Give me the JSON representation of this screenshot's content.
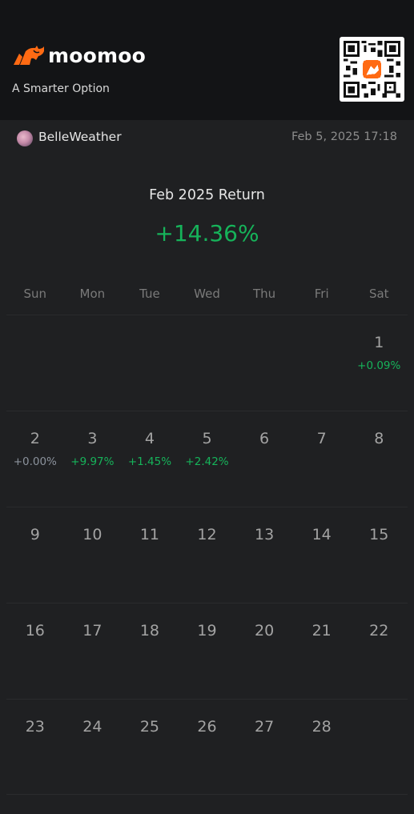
{
  "header": {
    "brand": "moomoo",
    "tagline": "A Smarter Option",
    "logo_icon": "bull-logo-icon",
    "qr_icon": "qr-code-icon",
    "brand_color": "#ff6a13"
  },
  "user": {
    "name": "BelleWeather",
    "timestamp": "Feb 5, 2025 17:18"
  },
  "summary": {
    "title": "Feb 2025 Return",
    "value": "+14.36%",
    "value_color": "#16b35a"
  },
  "calendar": {
    "weekdays": [
      "Sun",
      "Mon",
      "Tue",
      "Wed",
      "Thu",
      "Fri",
      "Sat"
    ],
    "weeks": [
      [
        {
          "day": "",
          "pct": ""
        },
        {
          "day": "",
          "pct": ""
        },
        {
          "day": "",
          "pct": ""
        },
        {
          "day": "",
          "pct": ""
        },
        {
          "day": "",
          "pct": ""
        },
        {
          "day": "",
          "pct": ""
        },
        {
          "day": "1",
          "pct": "+0.09%"
        }
      ],
      [
        {
          "day": "2",
          "pct": "+0.00%"
        },
        {
          "day": "3",
          "pct": "+9.97%"
        },
        {
          "day": "4",
          "pct": "+1.45%"
        },
        {
          "day": "5",
          "pct": "+2.42%"
        },
        {
          "day": "6",
          "pct": ""
        },
        {
          "day": "7",
          "pct": ""
        },
        {
          "day": "8",
          "pct": ""
        }
      ],
      [
        {
          "day": "9",
          "pct": ""
        },
        {
          "day": "10",
          "pct": ""
        },
        {
          "day": "11",
          "pct": ""
        },
        {
          "day": "12",
          "pct": ""
        },
        {
          "day": "13",
          "pct": ""
        },
        {
          "day": "14",
          "pct": ""
        },
        {
          "day": "15",
          "pct": ""
        }
      ],
      [
        {
          "day": "16",
          "pct": ""
        },
        {
          "day": "17",
          "pct": ""
        },
        {
          "day": "18",
          "pct": ""
        },
        {
          "day": "19",
          "pct": ""
        },
        {
          "day": "20",
          "pct": ""
        },
        {
          "day": "21",
          "pct": ""
        },
        {
          "day": "22",
          "pct": ""
        }
      ],
      [
        {
          "day": "23",
          "pct": ""
        },
        {
          "day": "24",
          "pct": ""
        },
        {
          "day": "25",
          "pct": ""
        },
        {
          "day": "26",
          "pct": ""
        },
        {
          "day": "27",
          "pct": ""
        },
        {
          "day": "28",
          "pct": ""
        },
        {
          "day": "",
          "pct": ""
        }
      ]
    ]
  }
}
